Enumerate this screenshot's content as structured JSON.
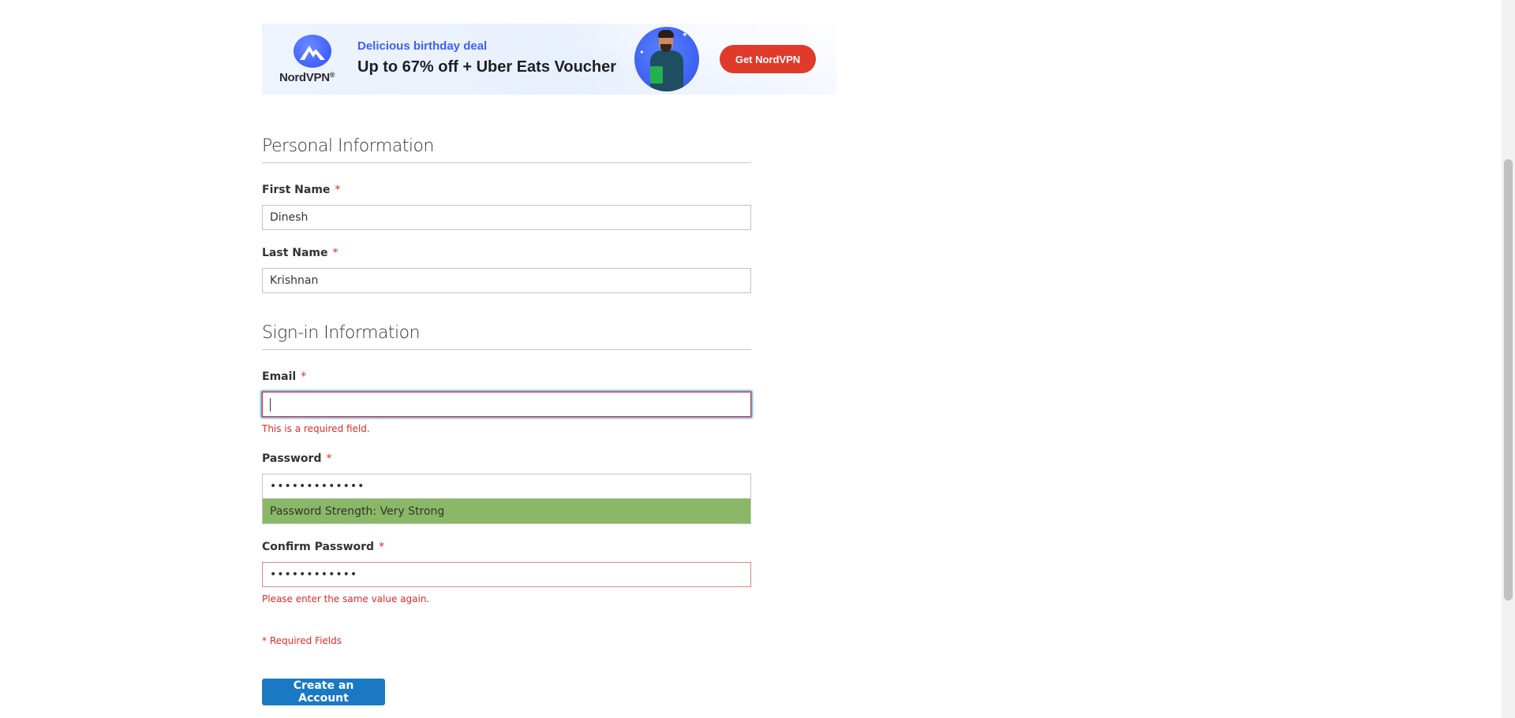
{
  "ad": {
    "brand": "NordVPN",
    "brand_mark": "®",
    "kicker": "Delicious birthday deal",
    "headline": "Up to 67% off + Uber Eats Voucher",
    "cta": "Get NordVPN",
    "accent_color": "#3e5fff",
    "cta_color": "#e03a2b"
  },
  "personal": {
    "legend": "Personal Information",
    "first_name": {
      "label": "First Name",
      "required_mark": "*",
      "value": "Dinesh"
    },
    "last_name": {
      "label": "Last Name",
      "required_mark": "*",
      "value": "Krishnan"
    }
  },
  "signin": {
    "legend": "Sign-in Information",
    "email": {
      "label": "Email",
      "required_mark": "*",
      "value": "",
      "error": "This is a required field."
    },
    "password": {
      "label": "Password",
      "required_mark": "*",
      "value_masked": "•••••••••••••",
      "strength": "Password Strength: Very Strong"
    },
    "confirm_password": {
      "label": "Confirm Password",
      "required_mark": "*",
      "value_masked": "••••••••••••",
      "error": "Please enter the same value again."
    }
  },
  "required_note": "* Required Fields",
  "submit_label": "Create an Account",
  "colors": {
    "primary_button": "#1979c3",
    "error": "#e02b27",
    "strength_very_strong": "#8ab866"
  }
}
